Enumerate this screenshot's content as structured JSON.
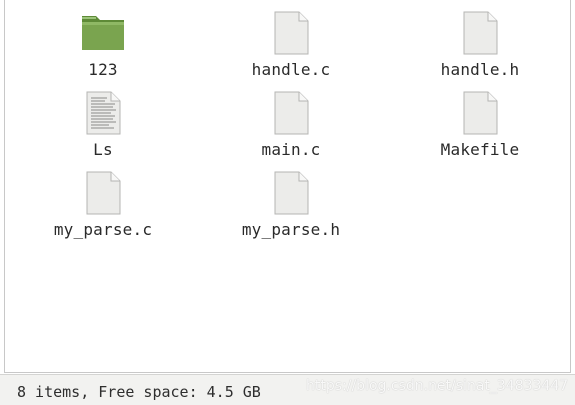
{
  "files": [
    {
      "name": "123",
      "type": "folder"
    },
    {
      "name": "handle.c",
      "type": "file"
    },
    {
      "name": "handle.h",
      "type": "file"
    },
    {
      "name": "Ls",
      "type": "text-file"
    },
    {
      "name": "main.c",
      "type": "file"
    },
    {
      "name": "Makefile",
      "type": "file"
    },
    {
      "name": "my_parse.c",
      "type": "file"
    },
    {
      "name": "my_parse.h",
      "type": "file"
    }
  ],
  "status": {
    "text": "8 items, Free space: 4.5 GB",
    "watermark": "https://blog.csdn.net/sinat_34833447"
  },
  "colors": {
    "folder": "#7aa44f",
    "folder_dark": "#5e8a37",
    "file_fill": "#ececea",
    "file_border": "#b5b5b3"
  }
}
